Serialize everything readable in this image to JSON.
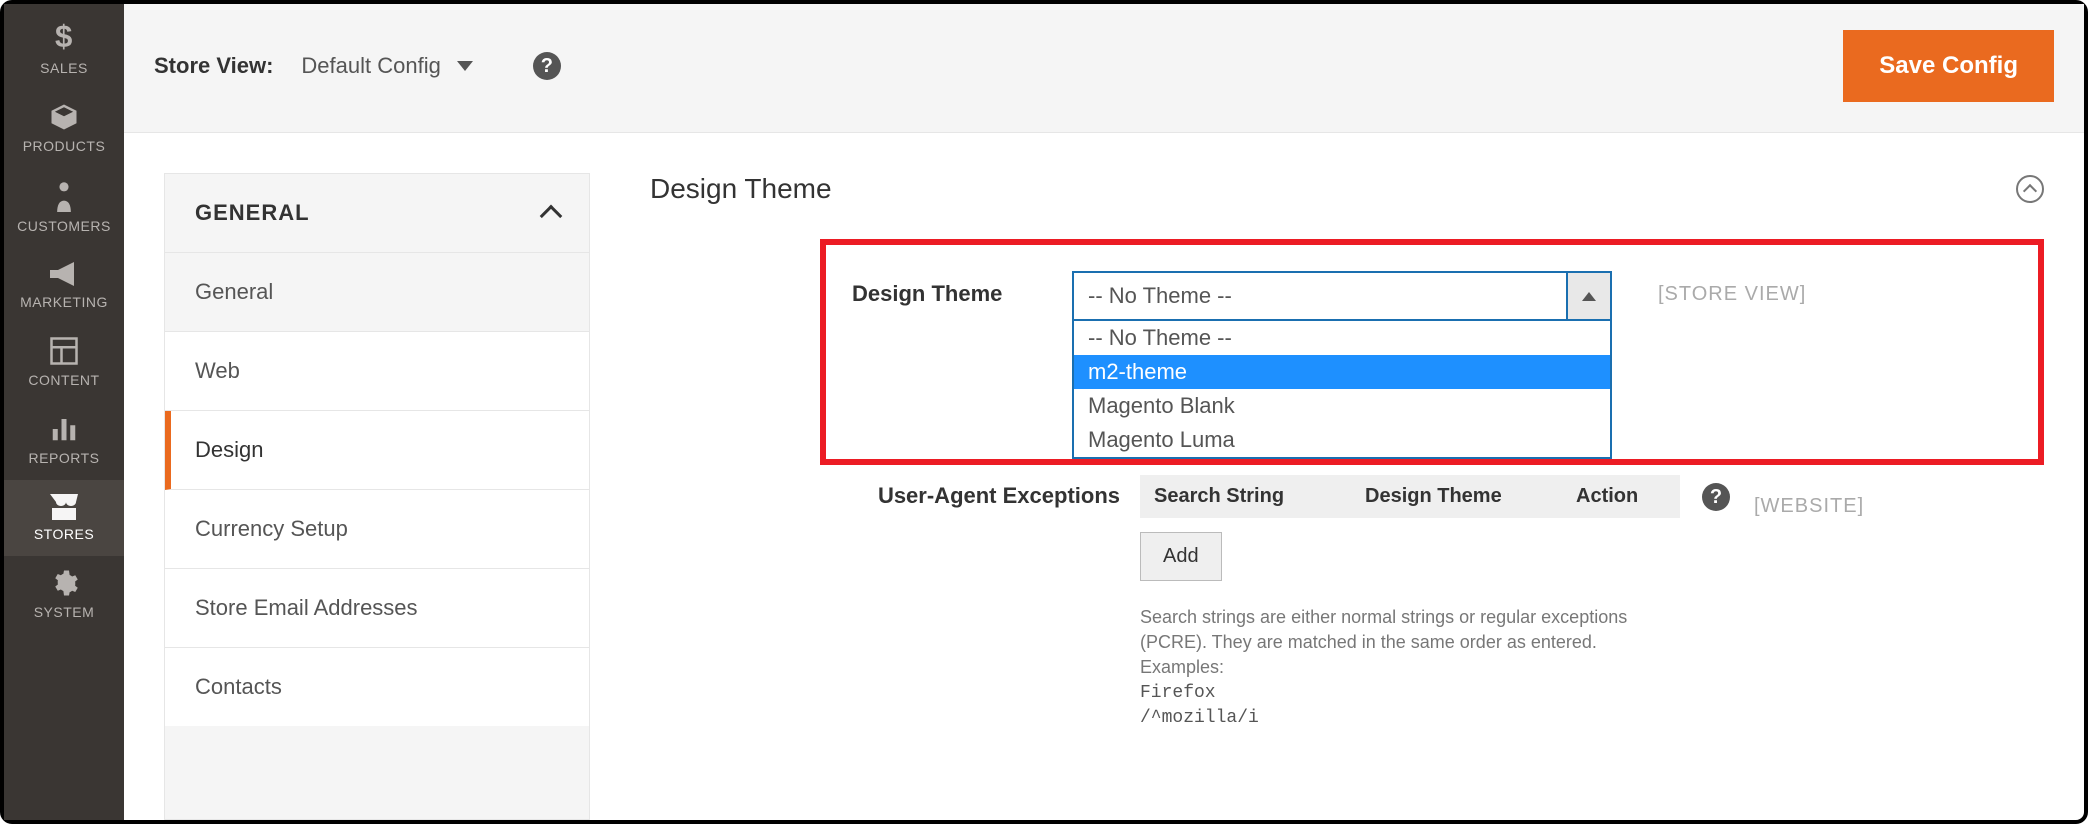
{
  "adminnav": {
    "items": [
      {
        "key": "sales",
        "label": "SALES",
        "active": false
      },
      {
        "key": "products",
        "label": "PRODUCTS",
        "active": false
      },
      {
        "key": "customers",
        "label": "CUSTOMERS",
        "active": false
      },
      {
        "key": "marketing",
        "label": "MARKETING",
        "active": false
      },
      {
        "key": "content",
        "label": "CONTENT",
        "active": false
      },
      {
        "key": "reports",
        "label": "REPORTS",
        "active": false
      },
      {
        "key": "stores",
        "label": "STORES",
        "active": true
      },
      {
        "key": "system",
        "label": "SYSTEM",
        "active": false
      }
    ]
  },
  "topbar": {
    "store_view_label": "Store View:",
    "store_view_value": "Default Config",
    "save_label": "Save Config"
  },
  "config_sidebar": {
    "group_title": "GENERAL",
    "items": [
      {
        "label": "General",
        "active": false
      },
      {
        "label": "Web",
        "active": false
      },
      {
        "label": "Design",
        "active": true
      },
      {
        "label": "Currency Setup",
        "active": false
      },
      {
        "label": "Store Email Addresses",
        "active": false
      },
      {
        "label": "Contacts",
        "active": false
      }
    ]
  },
  "section": {
    "title": "Design Theme"
  },
  "design_theme": {
    "label": "Design Theme",
    "selected_display": "-- No Theme --",
    "options": [
      {
        "label": "-- No Theme --",
        "selected": false
      },
      {
        "label": "m2-theme",
        "selected": true
      },
      {
        "label": "Magento Blank",
        "selected": false
      },
      {
        "label": "Magento Luma",
        "selected": false
      }
    ],
    "scope": "[STORE VIEW]"
  },
  "user_agent": {
    "label": "User-Agent Exceptions",
    "columns": {
      "search": "Search String",
      "theme": "Design Theme",
      "action": "Action"
    },
    "add_label": "Add",
    "scope": "[WEBSITE]",
    "help_line1": "Search strings are either normal strings or regular exceptions (PCRE). They are matched in the same order as entered. Examples:",
    "example1": "Firefox",
    "example2": "/^mozilla/i"
  },
  "icons": {
    "help": "?"
  }
}
